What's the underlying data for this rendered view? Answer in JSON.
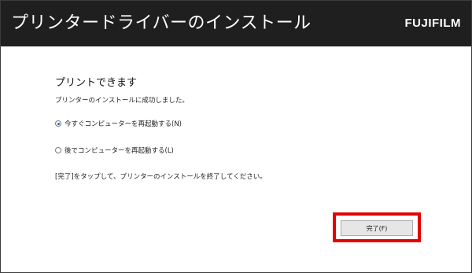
{
  "window": {
    "title": "プリンタードライバーのインストール",
    "brand": "FUJIFILM"
  },
  "main": {
    "heading": "プリントできます",
    "message": "プリンターのインストールに成功しました。",
    "options": [
      {
        "label": "今すぐコンピューターを再起動する(N)",
        "selected": true
      },
      {
        "label": "後でコンピューターを再起動する(L)",
        "selected": false
      }
    ],
    "note": "[完了]をタップして、プリンターのインストールを終了してください。",
    "finish_label": "完了(F)"
  },
  "colors": {
    "titlebar": "#1f1f1f",
    "highlight": "#e60000",
    "radio_dot": "#1e64c8"
  }
}
